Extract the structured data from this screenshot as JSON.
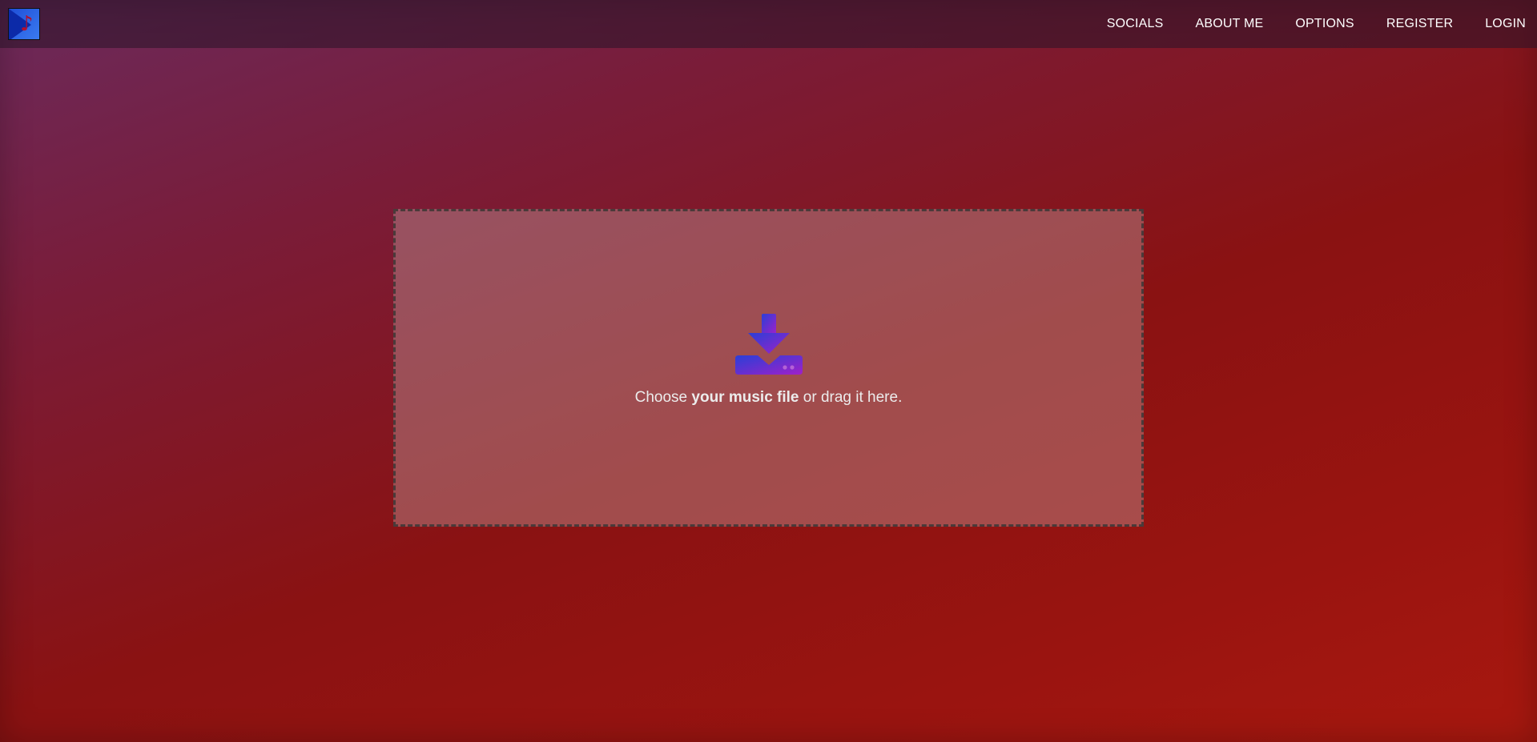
{
  "nav": {
    "logo_alt": "music app logo",
    "links": [
      "SOCIALS",
      "ABOUT ME",
      "OPTIONS",
      "REGISTER",
      "LOGIN"
    ]
  },
  "dropzone": {
    "prefix": "Choose ",
    "emphasis": "your music file",
    "suffix": " or drag it here.",
    "icon": "download-tray-icon"
  },
  "colors": {
    "icon_gradient_start": "#2a3fd8",
    "icon_gradient_end": "#a020c8"
  }
}
